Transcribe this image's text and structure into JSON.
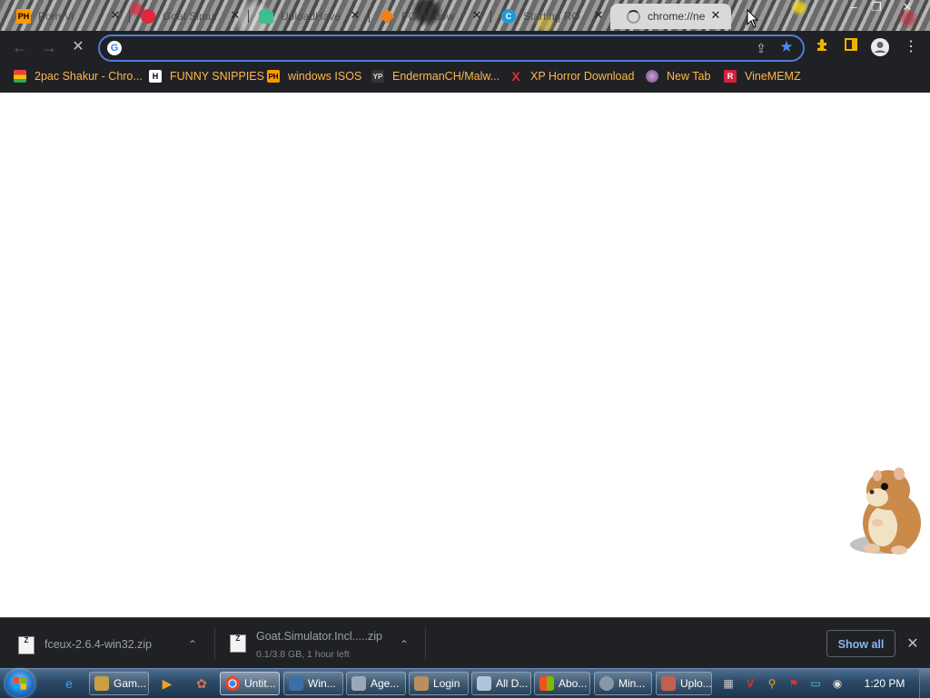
{
  "tabs": [
    {
      "title": "Porn Vi",
      "icon": "PH",
      "icon_name": "ph-favicon"
    },
    {
      "title": "Goat Simul",
      "icon": "",
      "icon_name": "goat-favicon"
    },
    {
      "title": "UploadHave",
      "icon": "",
      "icon_name": "uploadhaven-favicon"
    },
    {
      "title": "FCEU dow",
      "icon": "",
      "icon_name": "fceux-favicon"
    },
    {
      "title": "Starting RO",
      "icon": "C",
      "icon_name": "c-favicon"
    },
    {
      "title": "chrome://ne",
      "icon": "",
      "icon_name": "loading-spinner-icon"
    }
  ],
  "window_controls": {
    "minimize": "–",
    "maximize": "❐",
    "close": "✕"
  },
  "toolbar": {
    "back": "←",
    "forward": "→",
    "stop": "✕",
    "omnibox_value": "",
    "google_icon": "G"
  },
  "bookmarks": [
    {
      "label": "2pac Shakur - Chro...",
      "icon": "",
      "icon_name": "chrome-store-icon"
    },
    {
      "label": "FUNNY SNIPPIES",
      "icon": "H",
      "icon_name": "h-icon"
    },
    {
      "label": "windows ISOS",
      "icon": "PH",
      "icon_name": "ph-icon"
    },
    {
      "label": "EndermanCH/Malw...",
      "icon": "YP",
      "icon_name": "yp-icon"
    },
    {
      "label": "XP Horror Download",
      "icon": "X",
      "icon_name": "x-icon"
    },
    {
      "label": "New Tab",
      "icon": "",
      "icon_name": "globe-icon"
    },
    {
      "label": "VineMEMZ",
      "icon": "R",
      "icon_name": "r-icon"
    }
  ],
  "downloads": [
    {
      "name": "fceux-2.6.4-win32.zip",
      "status": ""
    },
    {
      "name": "Goat.Simulator.Incl.....zip",
      "status": "0.1/3.8 GB, 1 hour left"
    }
  ],
  "shelf": {
    "show_all": "Show all",
    "close": "✕"
  },
  "taskbar": {
    "items": [
      {
        "label": "Gam...",
        "icon_name": "games-icon"
      },
      {
        "label": "Untit...",
        "icon_name": "chrome-icon"
      },
      {
        "label": "Win...",
        "icon_name": "windows-app-icon"
      },
      {
        "label": "Age...",
        "icon_name": "agent-icon"
      },
      {
        "label": "Login",
        "icon_name": "login-icon"
      },
      {
        "label": "All D...",
        "icon_name": "folder-icon"
      },
      {
        "label": "Abo...",
        "icon_name": "about-icon"
      },
      {
        "label": "Min...",
        "icon_name": "gear-app-icon"
      },
      {
        "label": "Uplo...",
        "icon_name": "upload-app-icon"
      }
    ],
    "clock": "1:20 PM"
  },
  "colors": {
    "chrome_dark": "#202124",
    "bookmark_text": "#ffb84d",
    "omnibox_border": "#4b7ed8",
    "show_all_text": "#8ab4f8",
    "taskbar": "#2c4864"
  }
}
